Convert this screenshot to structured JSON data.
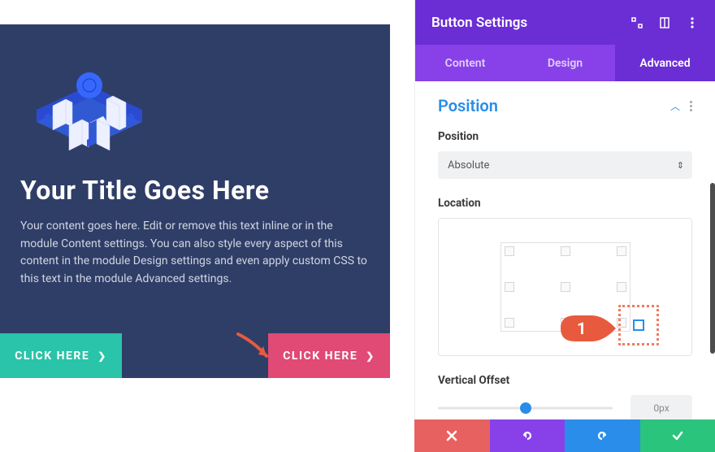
{
  "preview": {
    "title": "Your Title Goes Here",
    "body": "Your content goes here. Edit or remove this text inline or in the module Content settings. You can also style every aspect of this content in the module Design settings and even apply custom CSS to this text in the module Advanced settings.",
    "button_left": "CLICK HERE",
    "button_right": "CLICK HERE"
  },
  "panel": {
    "title": "Button Settings",
    "tabs": {
      "content": "Content",
      "design": "Design",
      "advanced": "Advanced",
      "active": "advanced"
    },
    "section": {
      "title": "Position",
      "position_label": "Position",
      "position_value": "Absolute",
      "location_label": "Location",
      "offset_label": "Vertical Offset",
      "offset_value": "0px",
      "active_corner": "bottom-right"
    }
  },
  "annotation": {
    "badge": "1"
  },
  "colors": {
    "purple_deep": "#6b2ed4",
    "purple": "#8841e8",
    "blue": "#2a8de9",
    "teal": "#29c4a9",
    "pink": "#e04a75",
    "green": "#2bc47d",
    "red": "#e86161",
    "orange": "#f27a5e"
  }
}
